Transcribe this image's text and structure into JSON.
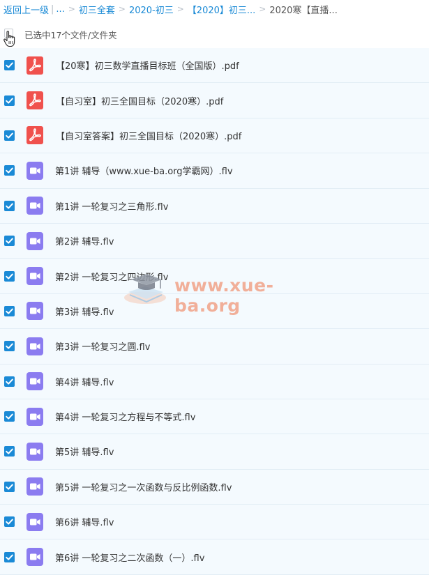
{
  "breadcrumb": {
    "back": "返回上一级",
    "ellipsis": "...",
    "items": [
      "初三全套",
      "2020-初三",
      "【2020】初三...",
      "2020寒【直播..."
    ]
  },
  "selection": {
    "text": "已选中17个文件/文件夹"
  },
  "files": [
    {
      "type": "pdf",
      "name": "【20寒】初三数学直播目标班（全国版）.pdf"
    },
    {
      "type": "pdf",
      "name": "【自习室】初三全国目标（2020寒）.pdf"
    },
    {
      "type": "pdf",
      "name": "【自习室答案】初三全国目标（2020寒）.pdf"
    },
    {
      "type": "video",
      "name": "第1讲 辅导（www.xue-ba.org学霸网）.flv"
    },
    {
      "type": "video",
      "name": "第1讲 一轮复习之三角形.flv"
    },
    {
      "type": "video",
      "name": "第2讲 辅导.flv"
    },
    {
      "type": "video",
      "name": "第2讲 一轮复习之四边形.flv"
    },
    {
      "type": "video",
      "name": "第3讲 辅导.flv"
    },
    {
      "type": "video",
      "name": "第3讲 一轮复习之圆.flv"
    },
    {
      "type": "video",
      "name": "第4讲 辅导.flv"
    },
    {
      "type": "video",
      "name": "第4讲 一轮复习之方程与不等式.flv"
    },
    {
      "type": "video",
      "name": "第5讲 辅导.flv"
    },
    {
      "type": "video",
      "name": "第5讲 一轮复习之一次函数与反比例函数.flv"
    },
    {
      "type": "video",
      "name": "第6讲 辅导.flv"
    },
    {
      "type": "video",
      "name": "第6讲 一轮复习之二次函数（一）.flv"
    }
  ],
  "watermark": {
    "text": "www.xue-ba.org"
  },
  "colors": {
    "accent": "#1a8ad6",
    "pdf_icon": "#f0514d",
    "video_icon": "#8b7cf0",
    "row_bg": "#f4fafe"
  },
  "icons": {
    "pdf": "pdf-file-icon",
    "video": "video-file-icon",
    "check": "check-icon"
  }
}
